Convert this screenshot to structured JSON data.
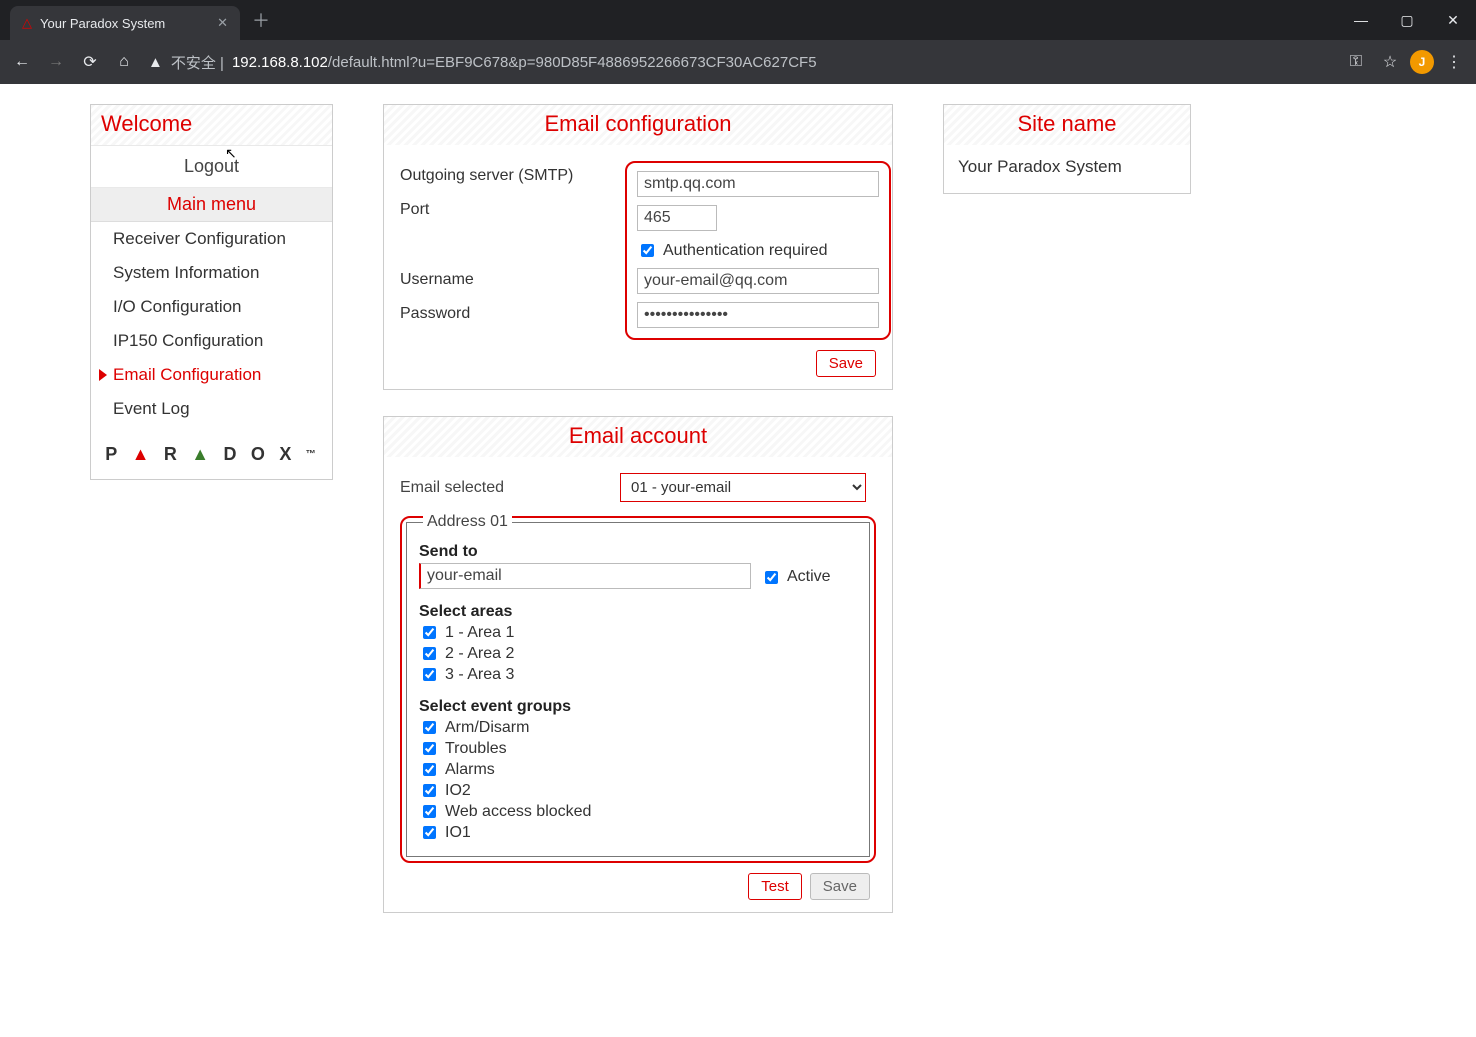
{
  "browser": {
    "tab_title": "Your Paradox System",
    "url_prefix": "不安全 |",
    "url_host": "192.168.8.102",
    "url_path": "/default.html?u=EBF9C678&p=980D85F4886952266673CF30AC627CF5",
    "avatar_letter": "J"
  },
  "sidebar": {
    "title": "Welcome",
    "logout": "Logout",
    "main_menu": "Main menu",
    "items": [
      {
        "label": "Receiver Configuration",
        "active": false
      },
      {
        "label": "System Information",
        "active": false
      },
      {
        "label": "I/O Configuration",
        "active": false
      },
      {
        "label": "IP150 Configuration",
        "active": false
      },
      {
        "label": "Email Configuration",
        "active": true
      },
      {
        "label": "Event Log",
        "active": false
      }
    ],
    "brand_text": "P A R A D O X ™"
  },
  "emailConfig": {
    "title": "Email configuration",
    "server_label": "Outgoing server (SMTP)",
    "server_value": "smtp.qq.com",
    "port_label": "Port",
    "port_value": "465",
    "auth_label": "Authentication required",
    "username_label": "Username",
    "username_value": "your-email@qq.com",
    "password_label": "Password",
    "password_value": "•••••••••••••••",
    "save": "Save"
  },
  "emailAccount": {
    "title": "Email account",
    "selected_label": "Email selected",
    "selected_value": "01 - your-email",
    "address_legend": "Address 01",
    "sendto_label": "Send to",
    "sendto_value": "your-email",
    "active_label": "Active",
    "areas_label": "Select areas",
    "areas": [
      {
        "label": "1 - Area 1"
      },
      {
        "label": "2 - Area 2"
      },
      {
        "label": "3 - Area 3"
      }
    ],
    "events_label": "Select event groups",
    "events": [
      {
        "label": "Arm/Disarm"
      },
      {
        "label": "Troubles"
      },
      {
        "label": "Alarms"
      },
      {
        "label": "IO2"
      },
      {
        "label": "Web access blocked"
      },
      {
        "label": "IO1"
      }
    ],
    "test": "Test",
    "save": "Save"
  },
  "site": {
    "title": "Site name",
    "value": "Your Paradox System"
  }
}
